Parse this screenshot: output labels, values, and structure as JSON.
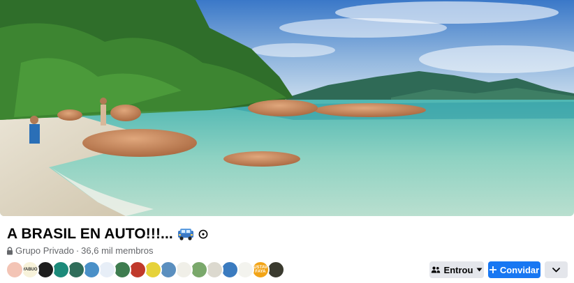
{
  "group": {
    "title": "A BRASIL EN AUTO!!!...",
    "title_emoji_icon": "car-icon",
    "privacy": "Grupo Privado",
    "separator": "·",
    "members": "36,6 mil membros"
  },
  "cover": {
    "description_icon": "beach-cover-photo"
  },
  "member_avatars": [
    {
      "name": "avatar-1",
      "color": "#f3c4b5",
      "text": ""
    },
    {
      "name": "avatar-2",
      "color": "#f7f2da",
      "text": "YABUO"
    },
    {
      "name": "avatar-3",
      "color": "#1e1e1e",
      "text": ""
    },
    {
      "name": "avatar-4",
      "color": "#1c8a7a",
      "text": ""
    },
    {
      "name": "avatar-5",
      "color": "#2f6d5a",
      "text": ""
    },
    {
      "name": "avatar-6",
      "color": "#4a90c8",
      "text": ""
    },
    {
      "name": "avatar-7",
      "color": "#e7eef7",
      "text": ""
    },
    {
      "name": "avatar-8",
      "color": "#3e7c4f",
      "text": ""
    },
    {
      "name": "avatar-9",
      "color": "#c0392b",
      "text": ""
    },
    {
      "name": "avatar-10",
      "color": "#e6d23a",
      "text": ""
    },
    {
      "name": "avatar-11",
      "color": "#5b8fbf",
      "text": ""
    },
    {
      "name": "avatar-12",
      "color": "#f0efe8",
      "text": ""
    },
    {
      "name": "avatar-13",
      "color": "#7aa86b",
      "text": ""
    },
    {
      "name": "avatar-14",
      "color": "#dcd9cf",
      "text": ""
    },
    {
      "name": "avatar-15",
      "color": "#3b7bbf",
      "text": ""
    },
    {
      "name": "avatar-16",
      "color": "#f3f3ee",
      "text": ""
    },
    {
      "name": "avatar-17",
      "color": "#f2a417",
      "text": "GUSTAVO FAYA"
    },
    {
      "name": "avatar-18",
      "color": "#3a3a2e",
      "text": ""
    }
  ],
  "actions": {
    "joined_label": "Entrou",
    "invite_label": "Convidar"
  },
  "colors": {
    "primary": "#1877f2",
    "secondary_button": "#e4e6eb",
    "muted_text": "#65676b"
  }
}
